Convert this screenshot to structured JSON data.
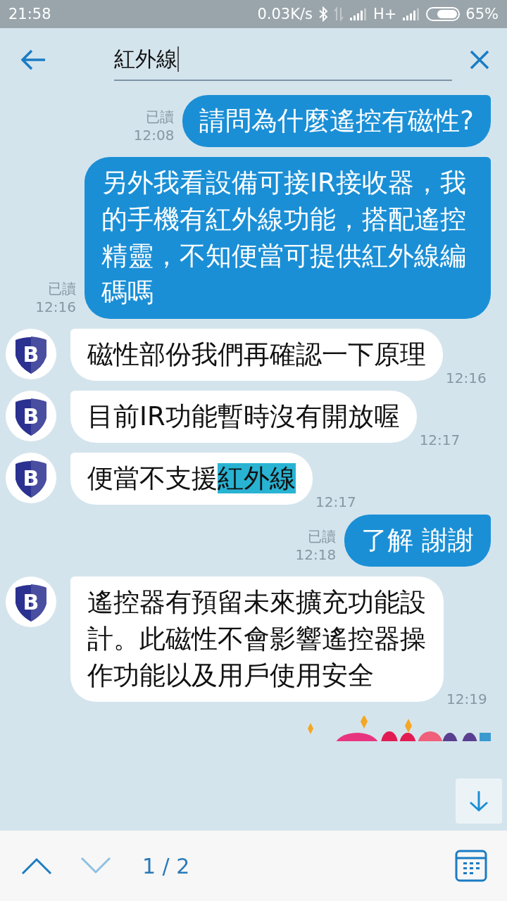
{
  "status_bar": {
    "time": "21:58",
    "speed": "0.03K/s",
    "network": "H+",
    "battery": "65%"
  },
  "search": {
    "value": "紅外線"
  },
  "messages": [
    {
      "kind": "outgoing",
      "read_label": "已讀",
      "time": "12:08",
      "parts": [
        {
          "text": "請問為什麼遙控有磁性?",
          "highlight": false
        }
      ]
    },
    {
      "kind": "outgoing",
      "read_label": "已讀",
      "time": "12:16",
      "parts": [
        {
          "text": "另外我看設備可接IR接收器，我的手機有紅外線功能，搭配遙控精靈，不知便當可提供紅外線編碼嗎",
          "highlight": false
        }
      ]
    },
    {
      "kind": "incoming",
      "avatar": "B",
      "time": "12:16",
      "parts": [
        {
          "text": "磁性部份我們再確認一下原理",
          "highlight": false
        }
      ]
    },
    {
      "kind": "incoming",
      "avatar": "B",
      "time": "12:17",
      "parts": [
        {
          "text": "目前IR功能暫時沒有開放喔",
          "highlight": false
        }
      ]
    },
    {
      "kind": "incoming",
      "avatar": "B",
      "time": "12:17",
      "parts": [
        {
          "text": "便當不支援",
          "highlight": false
        },
        {
          "text": "紅外線",
          "highlight": true
        }
      ]
    },
    {
      "kind": "outgoing",
      "read_label": "已讀",
      "time": "12:18",
      "parts": [
        {
          "text": "了解 謝謝",
          "highlight": false
        }
      ]
    },
    {
      "kind": "incoming",
      "avatar": "B",
      "time": "12:19",
      "parts": [
        {
          "text": "遙控器有預留未來擴充功能設計。此磁性不會影響遙控器操作功能以及用戶使用安全",
          "highlight": false
        }
      ]
    },
    {
      "kind": "sticker"
    }
  ],
  "navigator": {
    "counter": "1 / 2",
    "up_disabled": false,
    "down_disabled": true
  }
}
